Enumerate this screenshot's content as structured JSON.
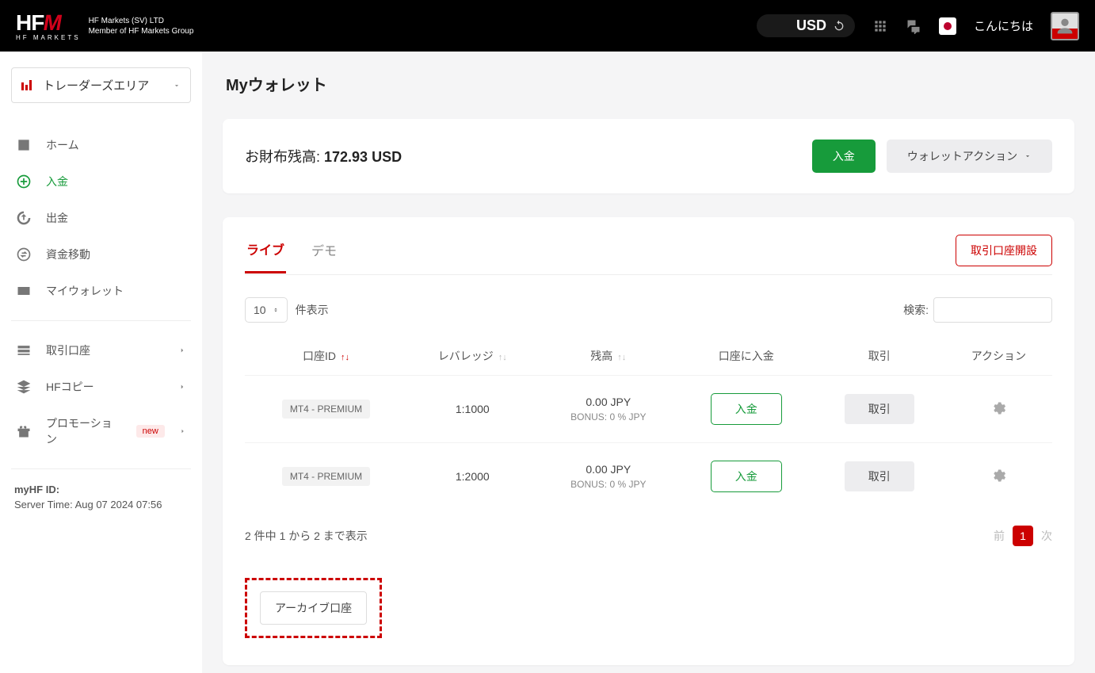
{
  "header": {
    "logo_main": "HF",
    "logo_accent": "M",
    "logo_sub": "HF MARKETS",
    "company_line1": "HF Markets (SV) LTD",
    "company_line2": "Member of HF Markets Group",
    "currency": "USD",
    "greeting": "こんにちは"
  },
  "sidebar": {
    "area_button": "トレーダーズエリア",
    "items": [
      {
        "label": "ホーム"
      },
      {
        "label": "入金"
      },
      {
        "label": "出金"
      },
      {
        "label": "資金移動"
      },
      {
        "label": "マイウォレット"
      }
    ],
    "items2": [
      {
        "label": "取引口座"
      },
      {
        "label": "HFコピー"
      },
      {
        "label": "プロモーション",
        "badge": "new"
      }
    ],
    "myhf_label": "myHF ID:",
    "server_time": "Server Time: Aug 07 2024 07:56"
  },
  "page": {
    "title": "Myウォレット",
    "balance_label": "お財布残高: ",
    "balance_value": "172.93 USD",
    "deposit_btn": "入金",
    "wallet_actions_btn": "ウォレットアクション"
  },
  "accounts": {
    "tab_live": "ライブ",
    "tab_demo": "デモ",
    "open_account_btn": "取引口座開設",
    "page_size_value": "10",
    "page_size_suffix": "件表示",
    "search_label": "検索:",
    "columns": {
      "id": "口座ID",
      "leverage": "レバレッジ",
      "balance": "残高",
      "deposit": "口座に入金",
      "trade": "取引",
      "action": "アクション"
    },
    "rows": [
      {
        "tag": "MT4 - PREMIUM",
        "leverage": "1:1000",
        "balance": "0.00 JPY",
        "bonus": "BONUS: 0 % JPY",
        "deposit_btn": "入金",
        "trade_btn": "取引"
      },
      {
        "tag": "MT4 - PREMIUM",
        "leverage": "1:2000",
        "balance": "0.00 JPY",
        "bonus": "BONUS: 0 % JPY",
        "deposit_btn": "入金",
        "trade_btn": "取引"
      }
    ],
    "footer_info": "2 件中 1 から 2 まで表示",
    "pager_prev": "前",
    "pager_page": "1",
    "pager_next": "次",
    "archive_btn": "アーカイブ口座"
  }
}
